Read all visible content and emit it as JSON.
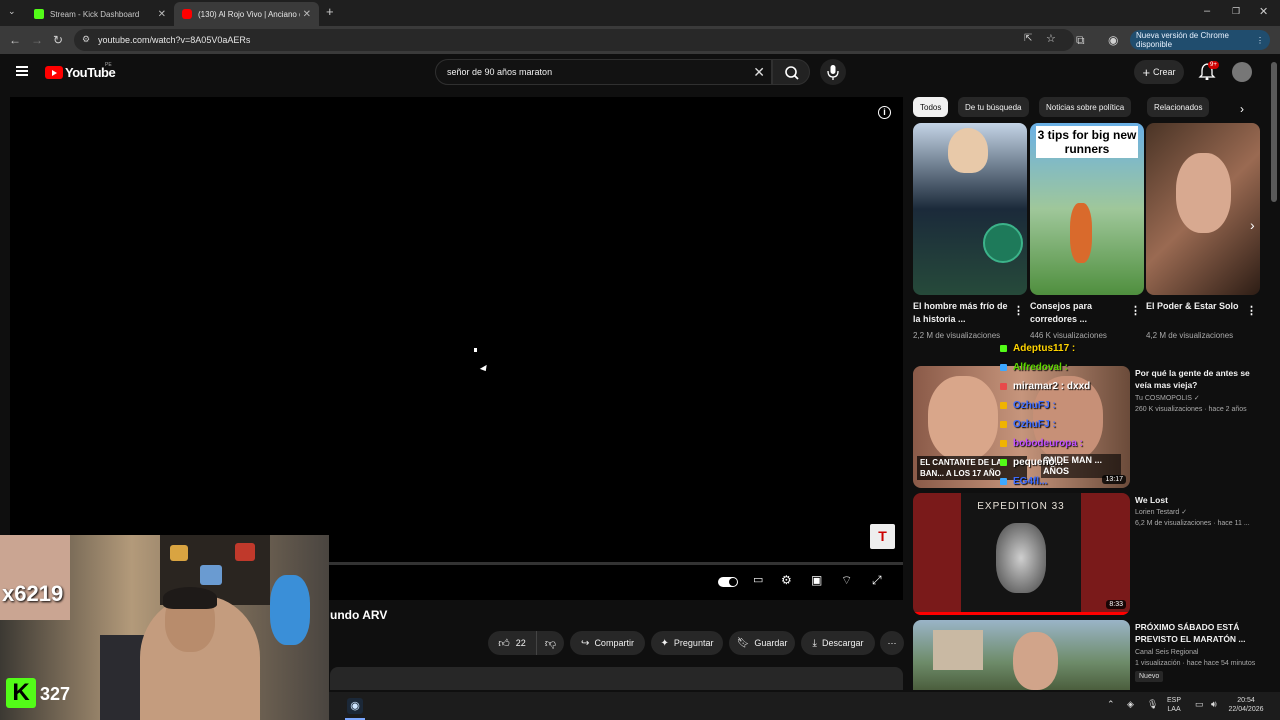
{
  "browser": {
    "tabs": [
      {
        "title": "Stream - Kick Dashboard",
        "favicon_color": "#53fc18"
      },
      {
        "title": "(130) Al Rojo Vivo | Anciano de",
        "favicon_color": "#ff0000"
      }
    ],
    "url": "youtube.com/watch?v=8A05V0aAERs",
    "update_button": "Nueva versión de Chrome disponible"
  },
  "youtube": {
    "logo_text": "YouTube",
    "country": "PE",
    "search_query": "señor de 90 años maraton",
    "create_label": "Crear",
    "notif_badge": "9+"
  },
  "video": {
    "title_fragment": "undo ARV",
    "likes": "22",
    "actions": {
      "share": "Compartir",
      "ask": "Preguntar",
      "save": "Guardar",
      "download": "Descargar"
    }
  },
  "stream_overlay": {
    "webcam_counter": "x6219",
    "viewer_count": "327"
  },
  "chips": [
    "Todos",
    "De tu búsqueda",
    "Noticias sobre política",
    "Relacionados"
  ],
  "shorts": [
    {
      "title": "El hombre más frío de la historia ...",
      "views": "2,2 M de visualizaciones"
    },
    {
      "title": "Consejos para corredores ...",
      "views": "446 K visualizaciones",
      "overlay_text": "3 tips for big new runners"
    },
    {
      "title": "El Poder & Estar Solo",
      "views": "4,2 M de visualizaciones"
    }
  ],
  "related": [
    {
      "title": "Por qué la gente de antes se veía mas vieja?",
      "channel": "Tu COSMOPOLIS",
      "meta": "260 K visualizaciones · hace 2 años",
      "thumb_text": "EL CANTANTE DE LA BAN... A LOS 17 AÑO",
      "thumb_text_right": "ONDE MAN ... AÑOS",
      "duration": "13:17"
    },
    {
      "title": "We Lost",
      "channel": "Lorien Testard",
      "meta": "6,2 M de visualizaciones · hace 11 ...",
      "thumb_text": "EXPEDITION 33",
      "duration": "8:33"
    },
    {
      "title": "PRÓXIMO SÁBADO ESTÁ PREVISTO EL MARATÓN ...",
      "channel": "Canal Seis Regional",
      "meta": "1 visualización · hace hace 54 minutos",
      "badge": "Nuevo"
    }
  ],
  "chat": [
    {
      "user": "Adeptus117 :",
      "color": "#ffd400"
    },
    {
      "user": "Alfredoval :",
      "color": "#5bd600"
    },
    {
      "user": "miramar2 : dxxd",
      "color": "#ffffff"
    },
    {
      "user": "OzhuFJ :",
      "color": "#3d6cff"
    },
    {
      "user": "OzhuFJ :",
      "color": "#3d6cff"
    },
    {
      "user": "bobodeuropa :",
      "color": "#c04fff"
    },
    {
      "user": "pequeño...",
      "color": "#ffffff"
    },
    {
      "user": "EG4fl...",
      "color": "#3d6cff"
    }
  ],
  "taskbar": {
    "lang": "ESP",
    "lang2": "LAA",
    "time": "20:54",
    "date": "22/04/2026"
  }
}
